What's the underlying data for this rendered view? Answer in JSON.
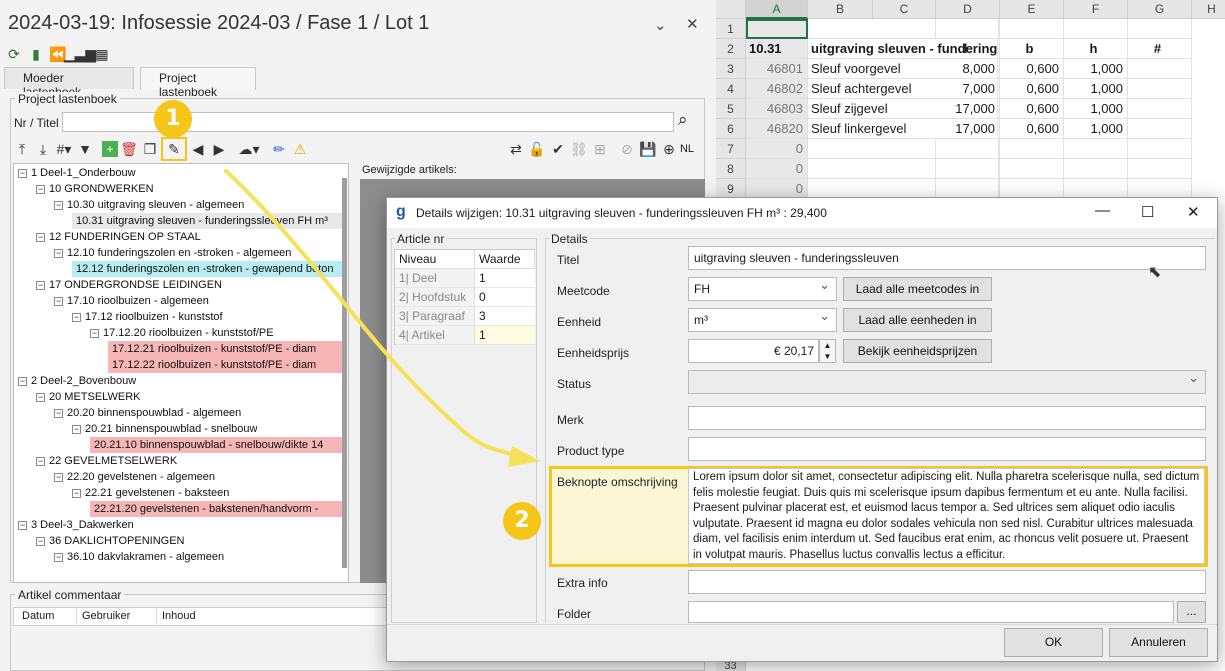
{
  "app": {
    "title": "2024-03-19: Infosessie 2024-03 / Fase 1 / Lot 1",
    "tabs": [
      "Moeder lastenboek",
      "Project lastenboek"
    ],
    "group_label": "Project lastenboek",
    "search_label": "Nr / Titel",
    "search_value": "",
    "lang": "NL",
    "changed_label": "Gewijzigde artikels:",
    "comment_label": "Artikel commentaar",
    "comment_columns": [
      "Datum",
      "Gebruiker",
      "Inhoud"
    ]
  },
  "tree": [
    {
      "text": "1 Deel-1_Onderbouw",
      "level": 0,
      "toggle": "-"
    },
    {
      "text": "10 GRONDWERKEN",
      "level": 1,
      "toggle": "-"
    },
    {
      "text": "10.30 uitgraving sleuven - algemeen",
      "level": 2,
      "toggle": "-"
    },
    {
      "text": "10.31 uitgraving sleuven - funderingssleuven FH m³",
      "level": 3,
      "toggle": "",
      "style": "hl"
    },
    {
      "text": "12 FUNDERINGEN OP STAAL",
      "level": 1,
      "toggle": "-"
    },
    {
      "text": "12.10 funderingszolen en -stroken - algemeen",
      "level": 2,
      "toggle": "-"
    },
    {
      "text": "12.12 funderingszolen en -stroken - gewapend beton",
      "level": 3,
      "toggle": "",
      "style": "cyan"
    },
    {
      "text": "17 ONDERGRONDSE LEIDINGEN",
      "level": 1,
      "toggle": "-"
    },
    {
      "text": "17.10 rioolbuizen - algemeen",
      "level": 2,
      "toggle": "-"
    },
    {
      "text": "17.12 rioolbuizen - kunststof",
      "level": 3,
      "toggle": "-"
    },
    {
      "text": "17.12.20 rioolbuizen - kunststof/PE",
      "level": 4,
      "toggle": "-"
    },
    {
      "text": "17.12.21 rioolbuizen - kunststof/PE - diam",
      "level": 5,
      "toggle": "",
      "style": "pink"
    },
    {
      "text": "17.12.22 rioolbuizen - kunststof/PE - diam",
      "level": 5,
      "toggle": "",
      "style": "pink"
    },
    {
      "text": "2 Deel-2_Bovenbouw",
      "level": 0,
      "toggle": "-"
    },
    {
      "text": "20 METSELWERK",
      "level": 1,
      "toggle": "-"
    },
    {
      "text": "20.20 binnenspouwblad - algemeen",
      "level": 2,
      "toggle": "-"
    },
    {
      "text": "20.21 binnenspouwblad - snelbouw",
      "level": 3,
      "toggle": "-"
    },
    {
      "text": "20.21.10 binnenspouwblad - snelbouw/dikte 14",
      "level": 4,
      "toggle": "",
      "style": "pink"
    },
    {
      "text": "22 GEVELMETSELWERK",
      "level": 1,
      "toggle": "-"
    },
    {
      "text": "22.20 gevelstenen - algemeen",
      "level": 2,
      "toggle": "-"
    },
    {
      "text": "22.21 gevelstenen - baksteen",
      "level": 3,
      "toggle": "-"
    },
    {
      "text": "22.21.20 gevelstenen - bakstenen/handvorm -",
      "level": 4,
      "toggle": "",
      "style": "pink"
    },
    {
      "text": "3 Deel-3_Dakwerken",
      "level": 0,
      "toggle": "-"
    },
    {
      "text": "36 DAKLICHTOPENINGEN",
      "level": 1,
      "toggle": "-"
    },
    {
      "text": "36.10 dakvlakramen - algemeen",
      "level": 2,
      "toggle": "-"
    }
  ],
  "excel": {
    "columns": [
      "A",
      "B",
      "C",
      "D",
      "E",
      "F",
      "G",
      "H"
    ],
    "rows": [
      {
        "n": "1",
        "a": "",
        "b": "",
        "e": "",
        "f": "",
        "g": "",
        "h": ""
      },
      {
        "n": "2",
        "a": "10.31",
        "b": "uitgraving sleuven - funderings",
        "e": "l",
        "f": "b",
        "g": "h",
        "h": "#"
      },
      {
        "n": "3",
        "a": "46801",
        "b": "Sleuf voorgevel",
        "e": "8,000",
        "f": "0,600",
        "g": "1,000",
        "h": ""
      },
      {
        "n": "4",
        "a": "46802",
        "b": "Sleuf achtergevel",
        "e": "7,000",
        "f": "0,600",
        "g": "1,000",
        "h": ""
      },
      {
        "n": "5",
        "a": "46803",
        "b": "Sleuf zijgevel",
        "e": "17,000",
        "f": "0,600",
        "g": "1,000",
        "h": ""
      },
      {
        "n": "6",
        "a": "46820",
        "b": "Sleuf linkergevel",
        "e": "17,000",
        "f": "0,600",
        "g": "1,000",
        "h": ""
      },
      {
        "n": "7",
        "a": "0",
        "b": "",
        "e": "",
        "f": "",
        "g": "",
        "h": ""
      },
      {
        "n": "8",
        "a": "0",
        "b": "",
        "e": "",
        "f": "",
        "g": "",
        "h": ""
      },
      {
        "n": "9",
        "a": "0",
        "b": "",
        "e": "",
        "f": "",
        "g": "",
        "h": ""
      }
    ],
    "bottom_row": "33"
  },
  "dialog": {
    "title": "Details wijzigen: 10.31 uitgraving sleuven - funderingssleuven FH m³ : 29,400",
    "article_group": "Article nr",
    "details_group": "Details",
    "article_headers": [
      "Niveau",
      "Waarde"
    ],
    "article_rows": [
      {
        "niveau": "1| Deel",
        "waarde": "1"
      },
      {
        "niveau": "2| Hoofdstuk",
        "waarde": "0"
      },
      {
        "niveau": "3| Paragraaf",
        "waarde": "3"
      },
      {
        "niveau": "4| Artikel",
        "waarde": "1"
      }
    ],
    "labels": {
      "titel": "Titel",
      "meetcode": "Meetcode",
      "eenheid": "Eenheid",
      "eenheidsprijs": "Eenheidsprijs",
      "status": "Status",
      "merk": "Merk",
      "product_type": "Product type",
      "beknopte": "Beknopte omschrijving",
      "extra_info": "Extra info",
      "folder": "Folder"
    },
    "values": {
      "titel": "uitgraving sleuven - funderingssleuven",
      "meetcode": "FH",
      "eenheid": "m³",
      "eenheidsprijs": "€ 20,17",
      "status": "",
      "merk": "",
      "product_type": "",
      "beknopte": "Lorem ipsum dolor sit amet, consectetur adipiscing elit. Nulla pharetra scelerisque nulla, sed dictum felis molestie feugiat. Duis quis mi scelerisque ipsum dapibus fermentum et eu ante. Nulla facilisi. Praesent pulvinar placerat est, et euismod lacus tempor a. Sed ultrices sem aliquet odio iaculis vulputate. Praesent id magna eu dolor sodales vehicula non sed nisl. Curabitur ultrices malesuada diam, vel facilisis enim interdum ut. Sed faucibus erat enim, ac rhoncus velit posuere ut. Praesent in volutpat mauris. Phasellus luctus convallis lectus a efficitur.",
      "extra_info": "",
      "folder": ""
    },
    "buttons": {
      "laad_meetcodes": "Laad alle meetcodes in",
      "laad_eenheden": "Laad alle eenheden in",
      "bekijk_prijzen": "Bekijk eenheidsprijzen",
      "folder_browse": "...",
      "ok": "OK",
      "annuleren": "Annuleren"
    }
  },
  "markers": {
    "one": "1",
    "two": "2"
  },
  "colors": {
    "accent": "#f5c518",
    "pink": "#f7b6b6",
    "cyan": "#b7eef2",
    "excel_green": "#217346"
  }
}
